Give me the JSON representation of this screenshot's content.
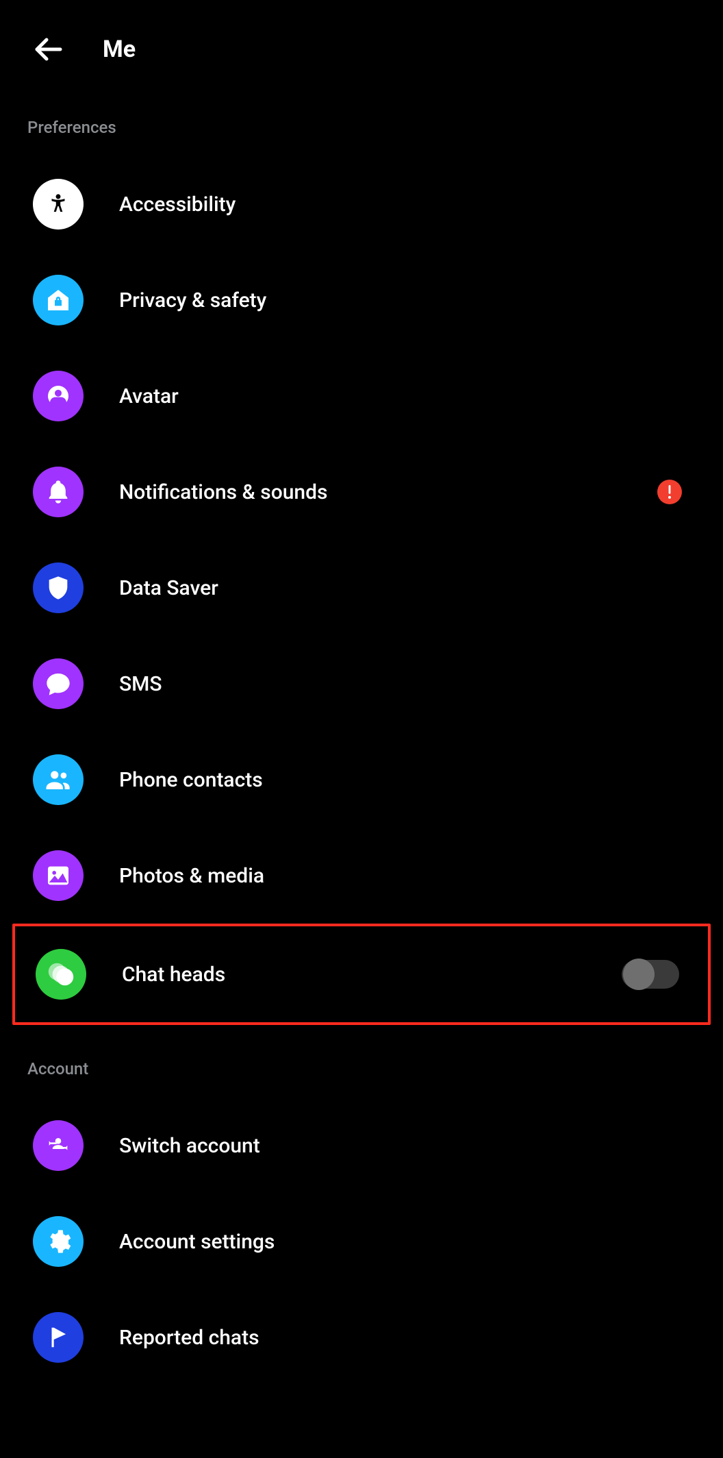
{
  "header": {
    "title": "Me"
  },
  "sections": {
    "preferences": {
      "title": "Preferences",
      "items": {
        "accessibility": {
          "label": "Accessibility",
          "iconBg": "#ffffff"
        },
        "privacy": {
          "label": "Privacy & safety",
          "iconBg": "#19b6ff"
        },
        "avatar": {
          "label": "Avatar",
          "iconBg": "#a033ff"
        },
        "notifications": {
          "label": "Notifications & sounds",
          "iconBg": "#a033ff",
          "alert": true
        },
        "datasaver": {
          "label": "Data Saver",
          "iconBg": "#1f3fe0"
        },
        "sms": {
          "label": "SMS",
          "iconBg": "#a033ff"
        },
        "contacts": {
          "label": "Phone contacts",
          "iconBg": "#19b6ff"
        },
        "photos": {
          "label": "Photos & media",
          "iconBg": "#a033ff"
        },
        "chatheads": {
          "label": "Chat heads",
          "iconBg": "#2ecc40",
          "toggle": false,
          "highlighted": true
        }
      }
    },
    "account": {
      "title": "Account",
      "items": {
        "switch": {
          "label": "Switch account",
          "iconBg": "#a033ff"
        },
        "settings": {
          "label": "Account settings",
          "iconBg": "#19b6ff"
        },
        "reported": {
          "label": "Reported chats",
          "iconBg": "#1f3fe0"
        }
      }
    }
  }
}
